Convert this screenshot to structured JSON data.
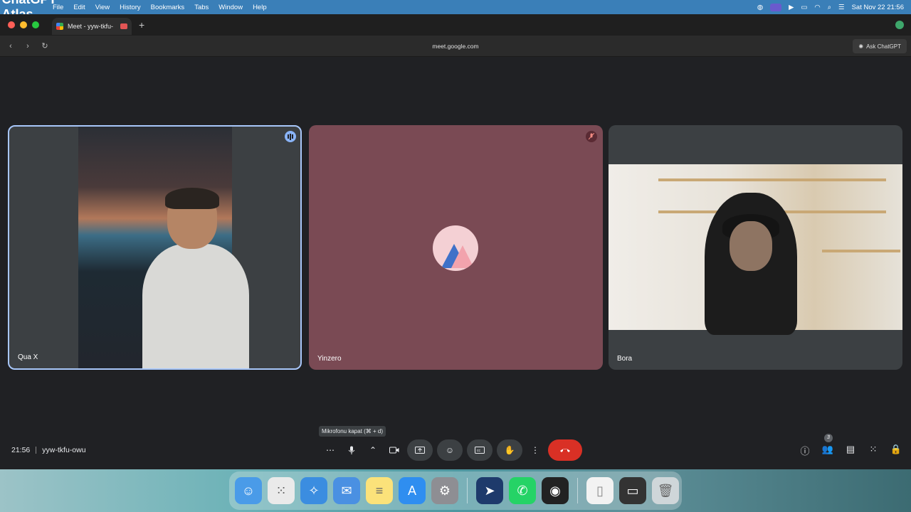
{
  "menubar": {
    "app_name": "ChatGPT Atlas",
    "items": [
      "File",
      "Edit",
      "View",
      "History",
      "Bookmarks",
      "Tabs",
      "Window",
      "Help"
    ],
    "datetime": "Sat Nov 22  21:56"
  },
  "browser": {
    "tab_title": "Meet - yyw-tkfu-",
    "url": "meet.google.com",
    "ask_label": "Ask ChatGPT"
  },
  "participants": [
    {
      "name": "Qua X",
      "speaking": true
    },
    {
      "name": "Yinzero",
      "muted": true
    },
    {
      "name": "Bora"
    }
  ],
  "meeting": {
    "time": "21:56",
    "code": "yyw-tkfu-owu",
    "mic_tooltip": "Mikrofonu kapat (⌘ + d)",
    "people_count": "3"
  },
  "colors": {
    "accent": "#a8c7fa",
    "end_call": "#d93025",
    "tile_bg": "#3c4043",
    "muted_tile": "#7a4a54"
  }
}
